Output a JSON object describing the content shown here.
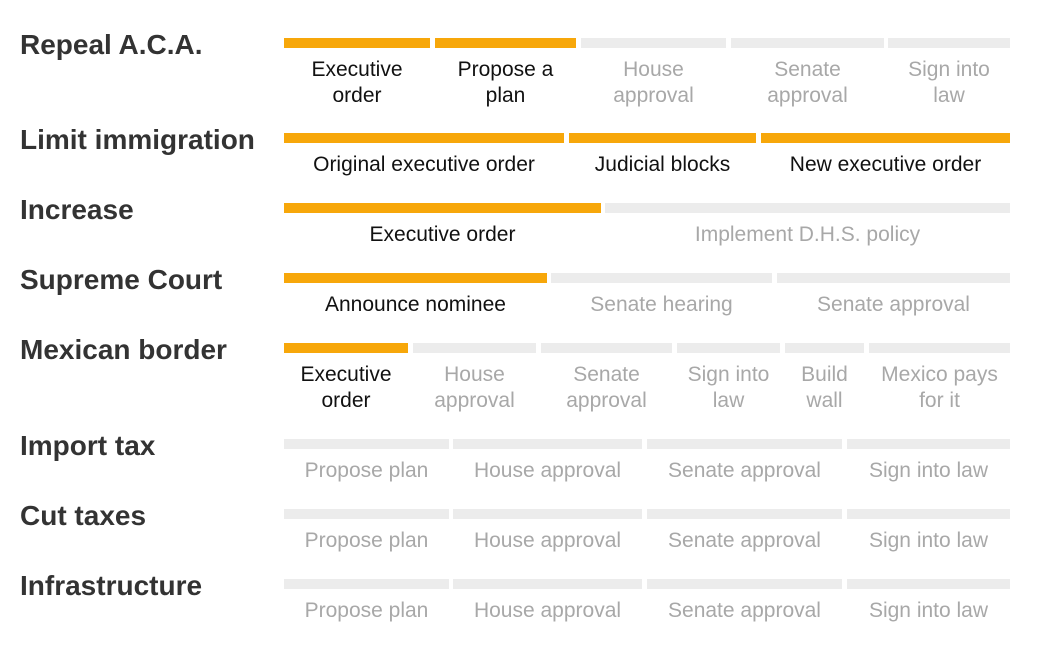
{
  "colors": {
    "done": "#f7a70a",
    "pending": "#ececec",
    "done_text": "#111111",
    "pending_text": "#a8a8a8",
    "title": "#333333"
  },
  "chart_data": {
    "type": "table",
    "title": "",
    "rows": [
      {
        "name": "Repeal A.C.A.",
        "steps": [
          {
            "label": "Executive order",
            "status": "done"
          },
          {
            "label": "Propose a plan",
            "status": "done"
          },
          {
            "label": "House approval",
            "status": "pending"
          },
          {
            "label": "Senate approval",
            "status": "pending"
          },
          {
            "label": "Sign into law",
            "status": "pending"
          }
        ]
      },
      {
        "name": "Limit immigration",
        "steps": [
          {
            "label": "Original executive order",
            "status": "done"
          },
          {
            "label": "Judicial blocks",
            "status": "done"
          },
          {
            "label": "New executive order",
            "status": "done"
          }
        ]
      },
      {
        "name": "Increase",
        "steps": [
          {
            "label": "Executive order",
            "status": "done"
          },
          {
            "label": "Implement D.H.S. policy",
            "status": "pending"
          }
        ]
      },
      {
        "name": "Supreme Court",
        "steps": [
          {
            "label": "Announce nominee",
            "status": "done"
          },
          {
            "label": "Senate hearing",
            "status": "pending"
          },
          {
            "label": "Senate approval",
            "status": "pending"
          }
        ]
      },
      {
        "name": "Mexican border",
        "steps": [
          {
            "label": "Executive order",
            "status": "done"
          },
          {
            "label": "House approval",
            "status": "pending"
          },
          {
            "label": "Senate approval",
            "status": "pending"
          },
          {
            "label": "Sign into law",
            "status": "pending"
          },
          {
            "label": "Build wall",
            "status": "pending"
          },
          {
            "label": "Mexico pays for it",
            "status": "pending"
          }
        ]
      },
      {
        "name": "Import tax",
        "steps": [
          {
            "label": "Propose plan",
            "status": "pending"
          },
          {
            "label": "House approval",
            "status": "pending"
          },
          {
            "label": "Senate approval",
            "status": "pending"
          },
          {
            "label": "Sign into law",
            "status": "pending"
          }
        ]
      },
      {
        "name": "Cut taxes",
        "steps": [
          {
            "label": "Propose plan",
            "status": "pending"
          },
          {
            "label": "House approval",
            "status": "pending"
          },
          {
            "label": "Senate approval",
            "status": "pending"
          },
          {
            "label": "Sign into law",
            "status": "pending"
          }
        ]
      },
      {
        "name": "Infrastructure",
        "steps": [
          {
            "label": "Propose plan",
            "status": "pending"
          },
          {
            "label": "House approval",
            "status": "pending"
          },
          {
            "label": "Senate approval",
            "status": "pending"
          },
          {
            "label": "Sign into law",
            "status": "pending"
          }
        ]
      }
    ]
  }
}
